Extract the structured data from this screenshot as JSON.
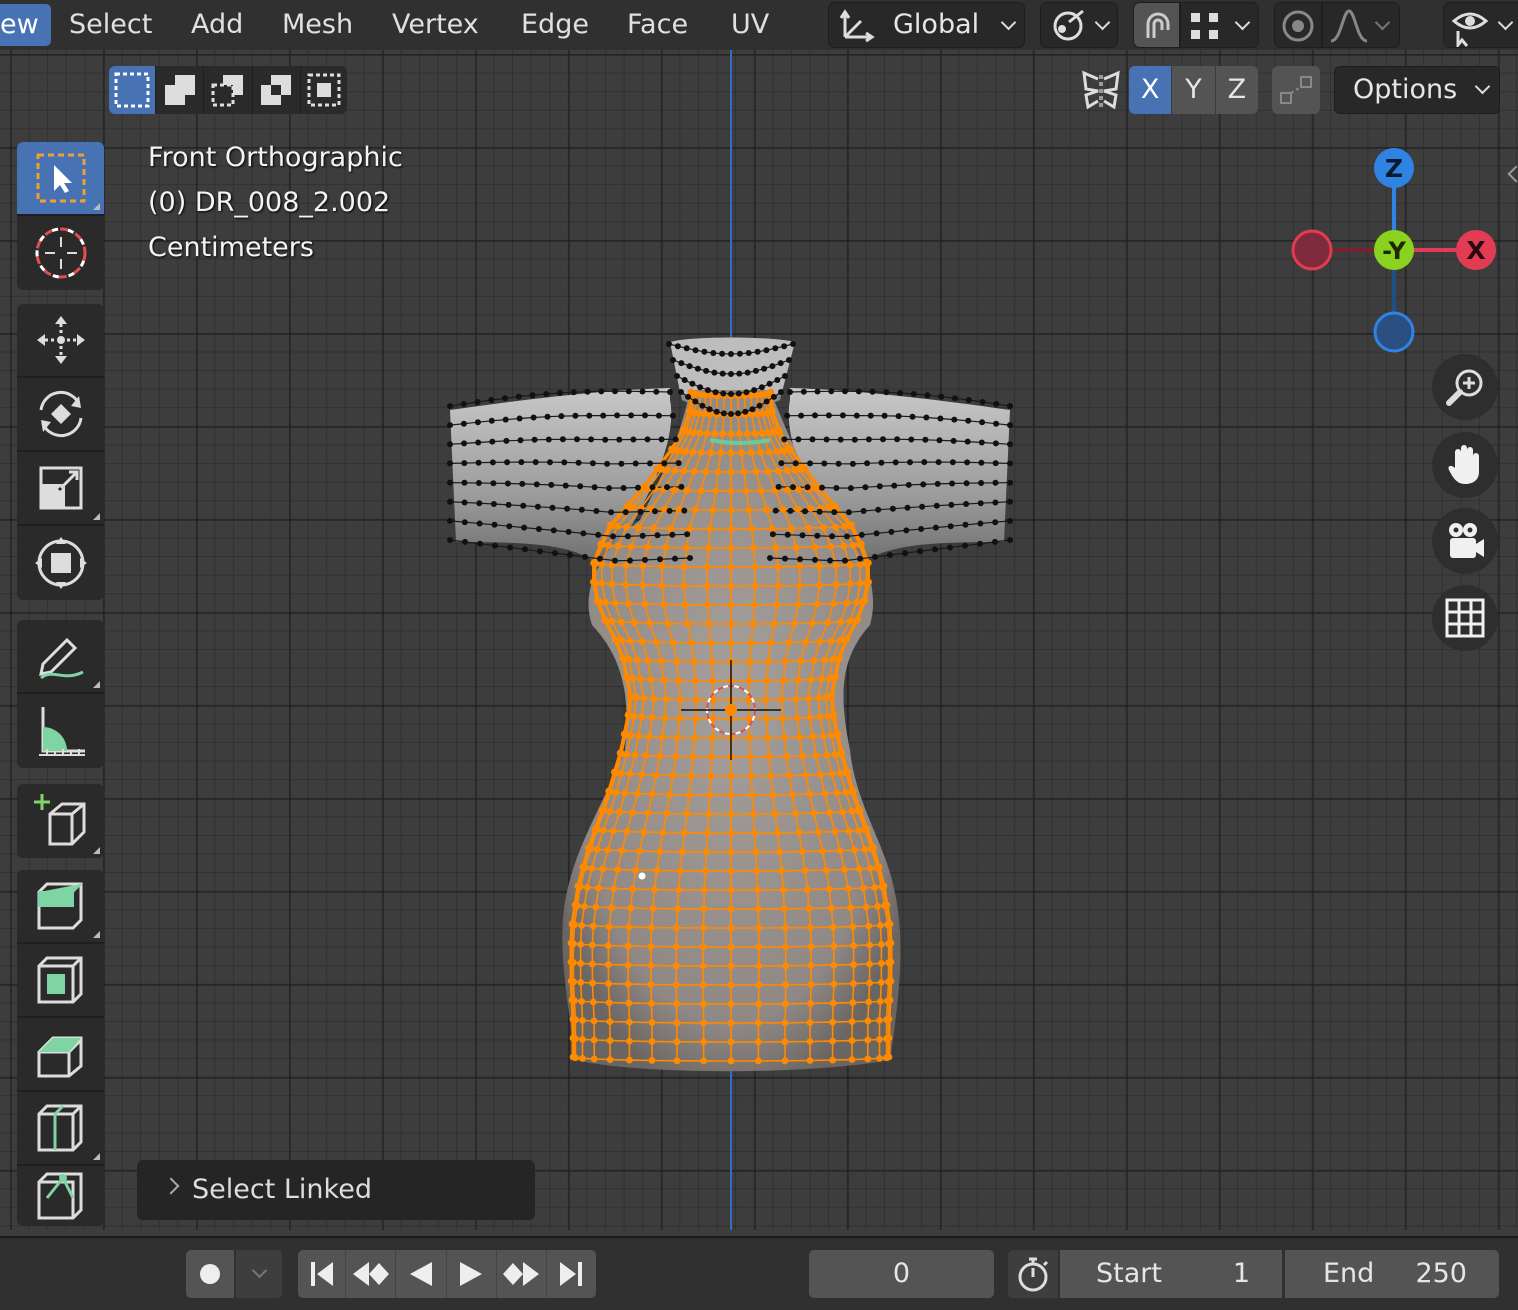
{
  "menubar": {
    "items": [
      "ew",
      "Select",
      "Add",
      "Mesh",
      "Vertex",
      "Edge",
      "Face",
      "UV"
    ],
    "transform_orientation": "Global",
    "options_label": "Options",
    "axes": [
      "X",
      "Y",
      "Z"
    ]
  },
  "viewport": {
    "view_name": "Front Orthographic",
    "object_info": "(0) DR_008_2.002",
    "units": "Centimeters"
  },
  "gizmo": {
    "z_label": "Z",
    "y_label": "-Y",
    "x_label": "X",
    "colors": {
      "x": "#e23c55",
      "y": "#8bd11f",
      "z": "#2f84e3"
    }
  },
  "operator_panel": {
    "label": "Select Linked"
  },
  "timeline": {
    "current_frame": "0",
    "start_label": "Start",
    "start_value": "1",
    "end_label": "End",
    "end_value": "250"
  },
  "colors": {
    "accent": "#4772b3",
    "selected": "#ff8a00",
    "background": "#3d3d3d"
  }
}
